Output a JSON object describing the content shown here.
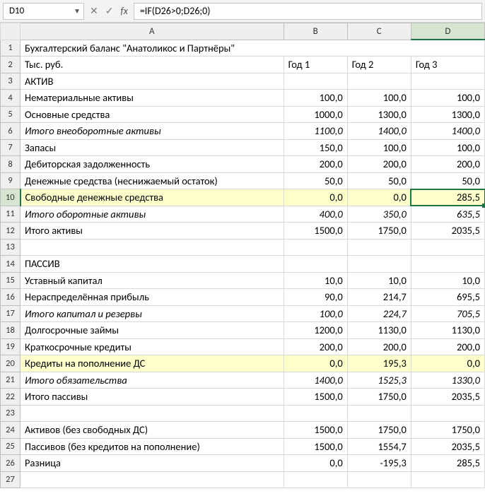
{
  "name_box": "D10",
  "formula": "=IF(D26>0;D26;0)",
  "col_letters": [
    "A",
    "B",
    "C",
    "D"
  ],
  "r1": {
    "a": "Бухгалтерский баланс \"Анатоликос и Партнёры\""
  },
  "r2": {
    "a": "Тыс. руб.",
    "b": "Год 1",
    "c": "Год 2",
    "d": "Год 3"
  },
  "r3": {
    "a": "АКТИВ"
  },
  "r4": {
    "a": "Нематериальные активы",
    "b": "100,0",
    "c": "100,0",
    "d": "100,0"
  },
  "r5": {
    "a": "Основные средства",
    "b": "1000,0",
    "c": "1300,0",
    "d": "1300,0"
  },
  "r6": {
    "a": "Итого внеоборотные активы",
    "b": "1100,0",
    "c": "1400,0",
    "d": "1400,0"
  },
  "r7": {
    "a": "Запасы",
    "b": "150,0",
    "c": "100,0",
    "d": "100,0"
  },
  "r8": {
    "a": "Дебиторская задолженность",
    "b": "200,0",
    "c": "200,0",
    "d": "200,0"
  },
  "r9": {
    "a": "Денежные средства (неснижаемый остаток)",
    "b": "50,0",
    "c": "50,0",
    "d": "50,0"
  },
  "r10": {
    "a": "Свободные денежные средства",
    "b": "0,0",
    "c": "0,0",
    "d": "285,5"
  },
  "r11": {
    "a": "Итого оборотные активы",
    "b": "400,0",
    "c": "350,0",
    "d": "635,5"
  },
  "r12": {
    "a": "Итого активы",
    "b": "1500,0",
    "c": "1750,0",
    "d": "2035,5"
  },
  "r14": {
    "a": "ПАССИВ"
  },
  "r15": {
    "a": "Уставный капитал",
    "b": "10,0",
    "c": "10,0",
    "d": "10,0"
  },
  "r16": {
    "a": "Нераспределённая прибыль",
    "b": "90,0",
    "c": "214,7",
    "d": "695,5"
  },
  "r17": {
    "a": "Итого капитал и резервы",
    "b": "100,0",
    "c": "224,7",
    "d": "705,5"
  },
  "r18": {
    "a": "Долгосрочные займы",
    "b": "1200,0",
    "c": "1130,0",
    "d": "1130,0"
  },
  "r19": {
    "a": "Краткосрочные кредиты",
    "b": "200,0",
    "c": "200,0",
    "d": "200,0"
  },
  "r20": {
    "a": "Кредиты на пополнение ДС",
    "b": "0,0",
    "c": "195,3",
    "d": "0,0"
  },
  "r21": {
    "a": "Итого обязательства",
    "b": "1400,0",
    "c": "1525,3",
    "d": "1330,0"
  },
  "r22": {
    "a": "Итого пассивы",
    "b": "1500,0",
    "c": "1750,0",
    "d": "2035,5"
  },
  "r24": {
    "a": "Активов (без свободных ДС)",
    "b": "1500,0",
    "c": "1750,0",
    "d": "1750,0"
  },
  "r25": {
    "a": "Пассивов (без кредитов на пополнение)",
    "b": "1500,0",
    "c": "1554,7",
    "d": "2035,5"
  },
  "r26": {
    "a": "Разница",
    "b": "0,0",
    "c": "-195,3",
    "d": "285,5"
  },
  "chart_data": {
    "type": "table",
    "title": "Бухгалтерский баланс \"Анатоликос и Партнёры\"",
    "unit": "Тыс. руб.",
    "columns": [
      "Год 1",
      "Год 2",
      "Год 3"
    ],
    "rows": [
      {
        "label": "Нематериальные активы",
        "values": [
          100.0,
          100.0,
          100.0
        ]
      },
      {
        "label": "Основные средства",
        "values": [
          1000.0,
          1300.0,
          1300.0
        ]
      },
      {
        "label": "Итого внеоборотные активы",
        "values": [
          1100.0,
          1400.0,
          1400.0
        ],
        "subtotal": true
      },
      {
        "label": "Запасы",
        "values": [
          150.0,
          100.0,
          100.0
        ]
      },
      {
        "label": "Дебиторская задолженность",
        "values": [
          200.0,
          200.0,
          200.0
        ]
      },
      {
        "label": "Денежные средства (неснижаемый остаток)",
        "values": [
          50.0,
          50.0,
          50.0
        ]
      },
      {
        "label": "Свободные денежные средства",
        "values": [
          0.0,
          0.0,
          285.5
        ],
        "highlight": true
      },
      {
        "label": "Итого оборотные активы",
        "values": [
          400.0,
          350.0,
          635.5
        ],
        "subtotal": true
      },
      {
        "label": "Итого активы",
        "values": [
          1500.0,
          1750.0,
          2035.5
        ],
        "total": true
      },
      {
        "label": "Уставный капитал",
        "values": [
          10.0,
          10.0,
          10.0
        ]
      },
      {
        "label": "Нераспределённая прибыль",
        "values": [
          90.0,
          214.7,
          695.5
        ]
      },
      {
        "label": "Итого капитал и резервы",
        "values": [
          100.0,
          224.7,
          705.5
        ],
        "subtotal": true
      },
      {
        "label": "Долгосрочные займы",
        "values": [
          1200.0,
          1130.0,
          1130.0
        ]
      },
      {
        "label": "Краткосрочные кредиты",
        "values": [
          200.0,
          200.0,
          200.0
        ]
      },
      {
        "label": "Кредиты на пополнение ДС",
        "values": [
          0.0,
          195.3,
          0.0
        ],
        "highlight": true
      },
      {
        "label": "Итого обязательства",
        "values": [
          1400.0,
          1525.3,
          1330.0
        ],
        "subtotal": true
      },
      {
        "label": "Итого пассивы",
        "values": [
          1500.0,
          1750.0,
          2035.5
        ],
        "total": true
      },
      {
        "label": "Активов (без свободных ДС)",
        "values": [
          1500.0,
          1750.0,
          1750.0
        ]
      },
      {
        "label": "Пассивов (без кредитов на пополнение)",
        "values": [
          1500.0,
          1554.7,
          2035.5
        ]
      },
      {
        "label": "Разница",
        "values": [
          0.0,
          -195.3,
          285.5
        ],
        "total": true
      }
    ]
  }
}
